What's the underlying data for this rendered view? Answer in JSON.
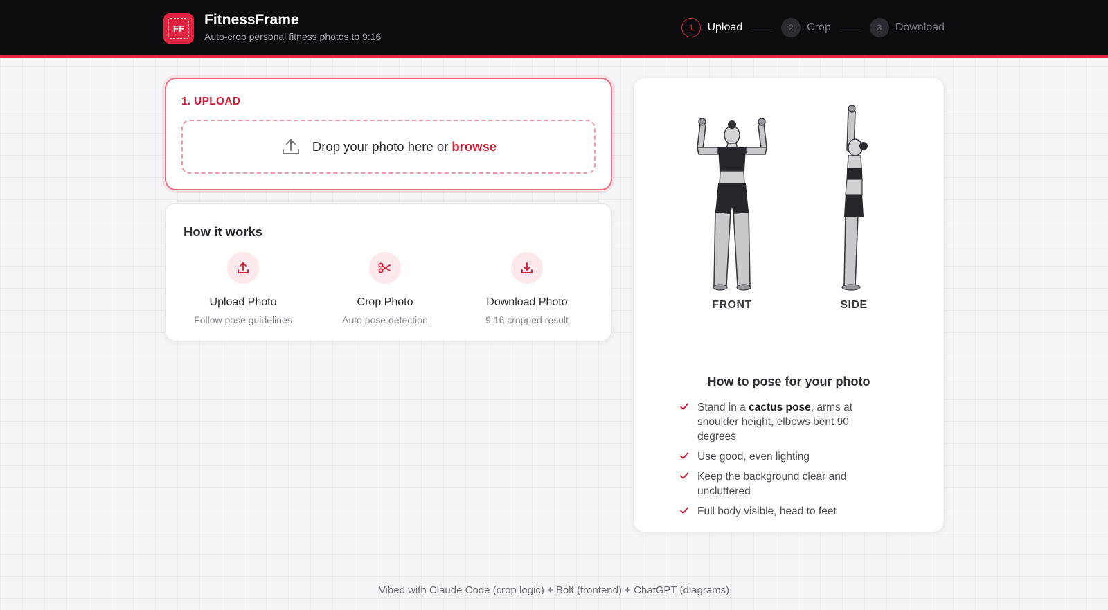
{
  "header": {
    "logo_text": "FF",
    "title": "FitnessFrame",
    "subtitle": "Auto-crop personal fitness photos to 9:16",
    "steps": [
      {
        "num": "1",
        "label": "Upload",
        "active": true
      },
      {
        "num": "2",
        "label": "Crop",
        "active": false
      },
      {
        "num": "3",
        "label": "Download",
        "active": false
      }
    ]
  },
  "upload": {
    "heading": "1. UPLOAD",
    "drop_text": "Drop your photo here or",
    "browse_label": "browse"
  },
  "how": {
    "title": "How it works",
    "items": [
      {
        "icon": "upload-icon",
        "label": "Upload Photo",
        "desc": "Follow pose guidelines"
      },
      {
        "icon": "scissors-icon",
        "label": "Crop Photo",
        "desc": "Auto pose detection"
      },
      {
        "icon": "download-icon",
        "label": "Download Photo",
        "desc": "9:16 cropped result"
      }
    ]
  },
  "pose": {
    "front_label": "FRONT",
    "side_label": "SIDE",
    "title": "How to pose for your photo",
    "tips": [
      {
        "pre": "Stand in a ",
        "bold": "cactus pose",
        "post": ", arms at shoulder height, elbows bent 90 degrees"
      },
      {
        "pre": "Use good, even lighting",
        "bold": "",
        "post": ""
      },
      {
        "pre": "Keep the background clear and uncluttered",
        "bold": "",
        "post": ""
      },
      {
        "pre": "Full body visible, head to feet",
        "bold": "",
        "post": ""
      }
    ]
  },
  "footer": {
    "text": "Vibed with Claude Code (crop logic) + Bolt (frontend) + ChatGPT (diagrams)"
  },
  "colors": {
    "accent": "#e0243f",
    "header_bg": "#0d0d10",
    "page_bg": "#f5f5f7"
  }
}
